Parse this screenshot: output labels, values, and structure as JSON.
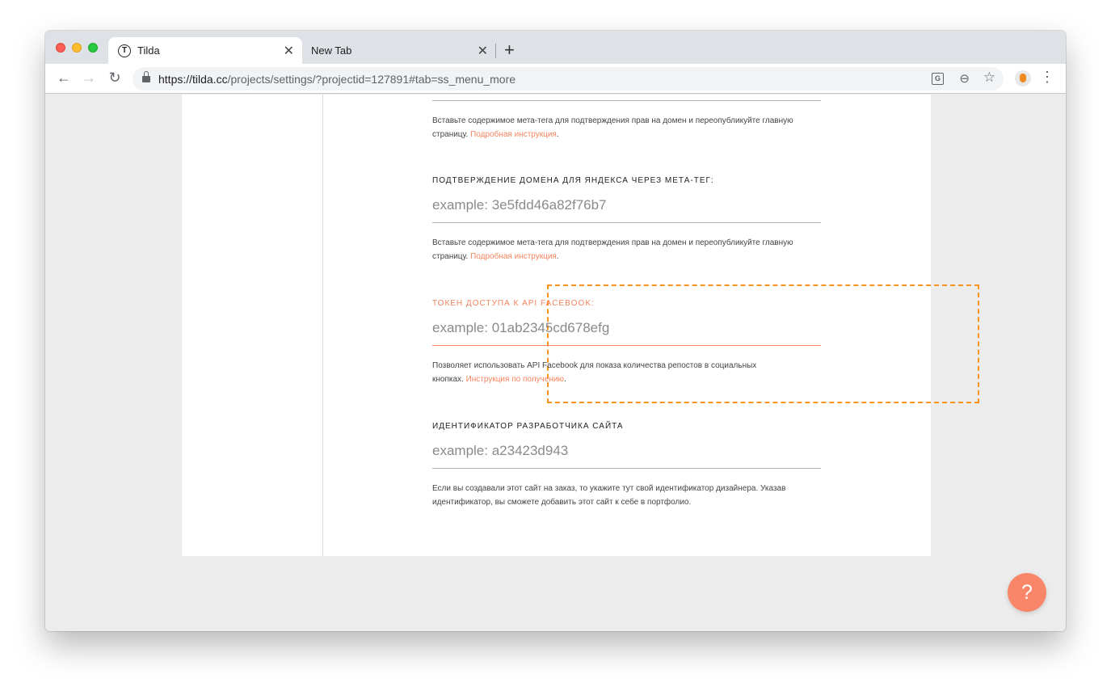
{
  "browser": {
    "tabs": [
      {
        "title": "Tilda",
        "favicon": "T",
        "close": "✕"
      },
      {
        "title": "New Tab",
        "close": "✕"
      }
    ],
    "new_tab": "+",
    "url_host": "https://tilda.cc",
    "url_path": "/projects/settings/?projectid=127891#tab=ss_menu_more",
    "translate_icon_text": "G"
  },
  "content": {
    "top_hint": {
      "text": "Вставьте содержимое мета-тега для подтверждения прав на домен и переопубликуйте главную страницу.",
      "link": "Подробная инструкция",
      "end": "."
    },
    "yandex": {
      "label": "ПОДТВЕРЖДЕНИЕ ДОМЕНА ДЛЯ ЯНДЕКСА ЧЕРЕЗ МЕТА-ТЕГ:",
      "placeholder": "example: 3e5fdd46a82f76b7",
      "hint_text": "Вставьте содержимое мета-тега для подтверждения прав на домен и переопубликуйте главную страницу.",
      "hint_link": "Подробная инструкция",
      "hint_end": "."
    },
    "facebook": {
      "label": "ТОКЕН ДОСТУПА К API FACEBOOK:",
      "placeholder": "example: 01ab2345cd678efg",
      "hint_text": "Позволяет использовать API Facebook для показа количества репостов в социальных кнопках.",
      "hint_link": "Инструкция по получению",
      "hint_end": "."
    },
    "developer": {
      "label": "ИДЕНТИФИКАТОР РАЗРАБОТЧИКА САЙТА",
      "placeholder": "example: a23423d943",
      "hint_text": "Если вы создавали этот сайт на заказ, то укажите тут свой идентификатор дизайнера. Указав идентификатор, вы сможете добавить этот сайт к себе в портфолио."
    }
  },
  "help_button": "?",
  "colors": {
    "accent": "#f4845f",
    "highlight": "#f7941d",
    "help": "#fa8669"
  }
}
